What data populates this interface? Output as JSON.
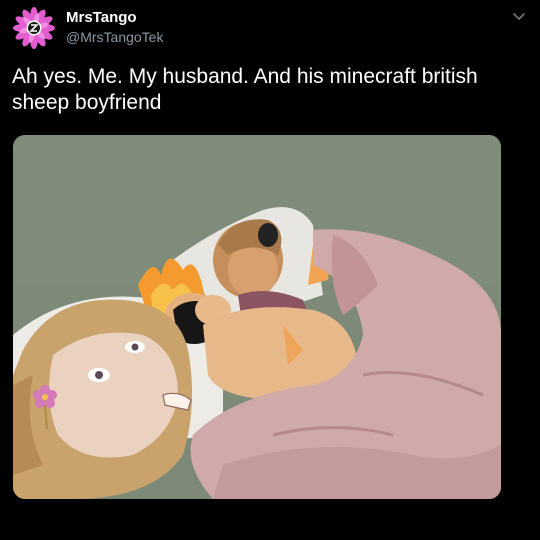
{
  "tweet": {
    "display_name": "MrsTango",
    "handle": "@MrsTangoTek",
    "text": "Ah yes. Me. My husband. And his minecraft british sheep boyfriend",
    "avatar_icon": "pink-daisy-avatar",
    "more_icon": "chevron-down-icon"
  },
  "colors": {
    "background": "#000000",
    "text": "#ffffff",
    "handle": "#8b98a5",
    "avatar_petals": "#e25ed0",
    "illustration_wall": "#7d8a78",
    "blanket": "#cfaaa9"
  }
}
